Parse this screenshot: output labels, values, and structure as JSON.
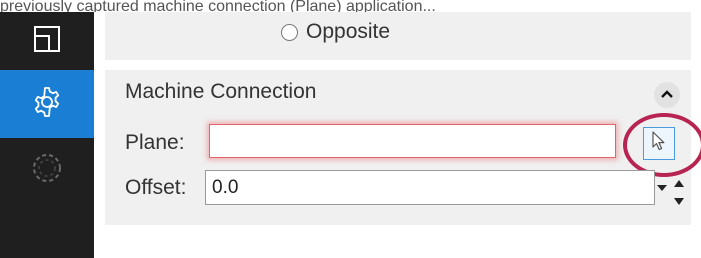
{
  "caption_fragment": "previously captured machine connection (Plane) application...",
  "sidebar": {
    "items": [
      {
        "icon": "layout-icon",
        "active": false
      },
      {
        "icon": "gear-icon",
        "active": true
      },
      {
        "icon": "dashed-circle-icon",
        "active": false
      }
    ]
  },
  "side_options": {
    "opposite_label": "Opposite"
  },
  "machine_connection": {
    "title": "Machine Connection",
    "collapse_icon": "chevron-up-icon",
    "plane": {
      "label": "Plane:",
      "value": "",
      "pick_icon": "cursor-pick-icon"
    },
    "offset": {
      "label": "Offset:",
      "value": "0.0"
    }
  },
  "colors": {
    "sidebar_bg": "#1f1f1f",
    "active_accent": "#1a7fd4",
    "error_border": "#e0666b",
    "highlight_ring": "#b82452"
  }
}
